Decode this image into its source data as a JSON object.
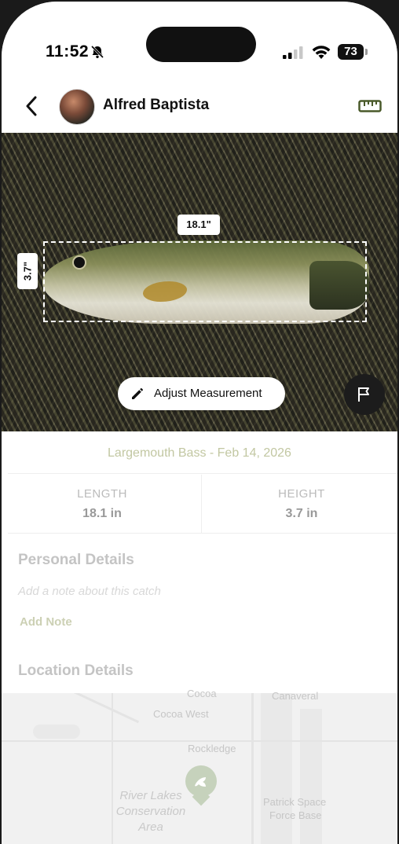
{
  "status": {
    "time": "11:52",
    "battery": "73"
  },
  "header": {
    "user_name": "Alfred Baptista"
  },
  "photo": {
    "length_tag": "18.1\"",
    "height_tag": "3.7\"",
    "adjust_button_label": "Adjust Measurement"
  },
  "catch": {
    "title": "Largemouth Bass - Feb 14, 2026",
    "stats": [
      {
        "label": "LENGTH",
        "value": "18.1 in"
      },
      {
        "label": "HEIGHT",
        "value": "3.7 in"
      }
    ]
  },
  "personal": {
    "heading": "Personal Details",
    "note_placeholder": "Add a note about this catch",
    "add_note_label": "Add Note"
  },
  "location": {
    "heading": "Location Details",
    "map_labels": [
      "Cocoa",
      "Canaveral",
      "Cocoa West",
      "Rockledge",
      "Patrick Space",
      "Force Base",
      "River Lakes",
      "Conservation",
      "Area"
    ]
  },
  "colors": {
    "accent_olive": "#c2c7a2",
    "ruler_icon": "#4a5a2a"
  }
}
